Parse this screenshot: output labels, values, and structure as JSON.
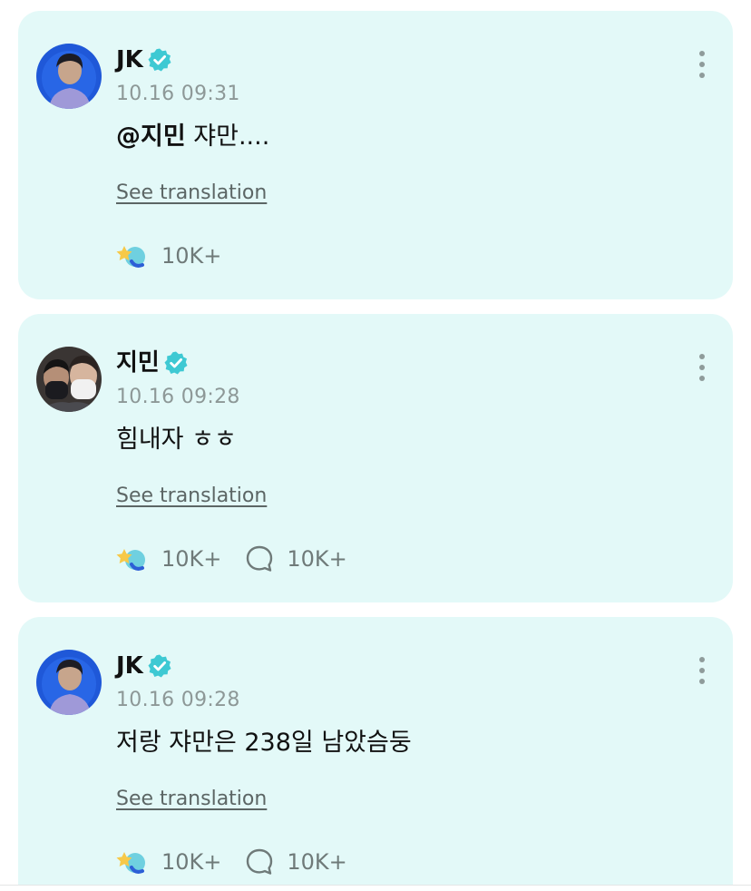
{
  "colors": {
    "card_bg": "#e3f9f8",
    "verified_badge": "#3ec9d3",
    "meta_text": "#8d9897",
    "count_text": "#6f7a79"
  },
  "icons": {
    "verified": "verified-badge-icon",
    "reaction": "sparkle-heart-reaction-icon",
    "comment": "speech-bubble-icon",
    "more": "vertical-ellipsis-icon"
  },
  "posts": [
    {
      "author": "JK",
      "time": "10.16 09:31",
      "mention": "@지민",
      "text": " 쟈만....",
      "translate": "See translation",
      "reactions": "10K+"
    },
    {
      "author": "지민",
      "time": "10.16 09:28",
      "text": "힘내자 ㅎㅎ",
      "translate": "See translation",
      "reactions": "10K+",
      "comments": "10K+"
    },
    {
      "author": "JK",
      "time": "10.16 09:28",
      "text": "저랑 쟈만은 238일 남았슴둥",
      "translate": "See translation",
      "reactions": "10K+",
      "comments": "10K+"
    }
  ]
}
